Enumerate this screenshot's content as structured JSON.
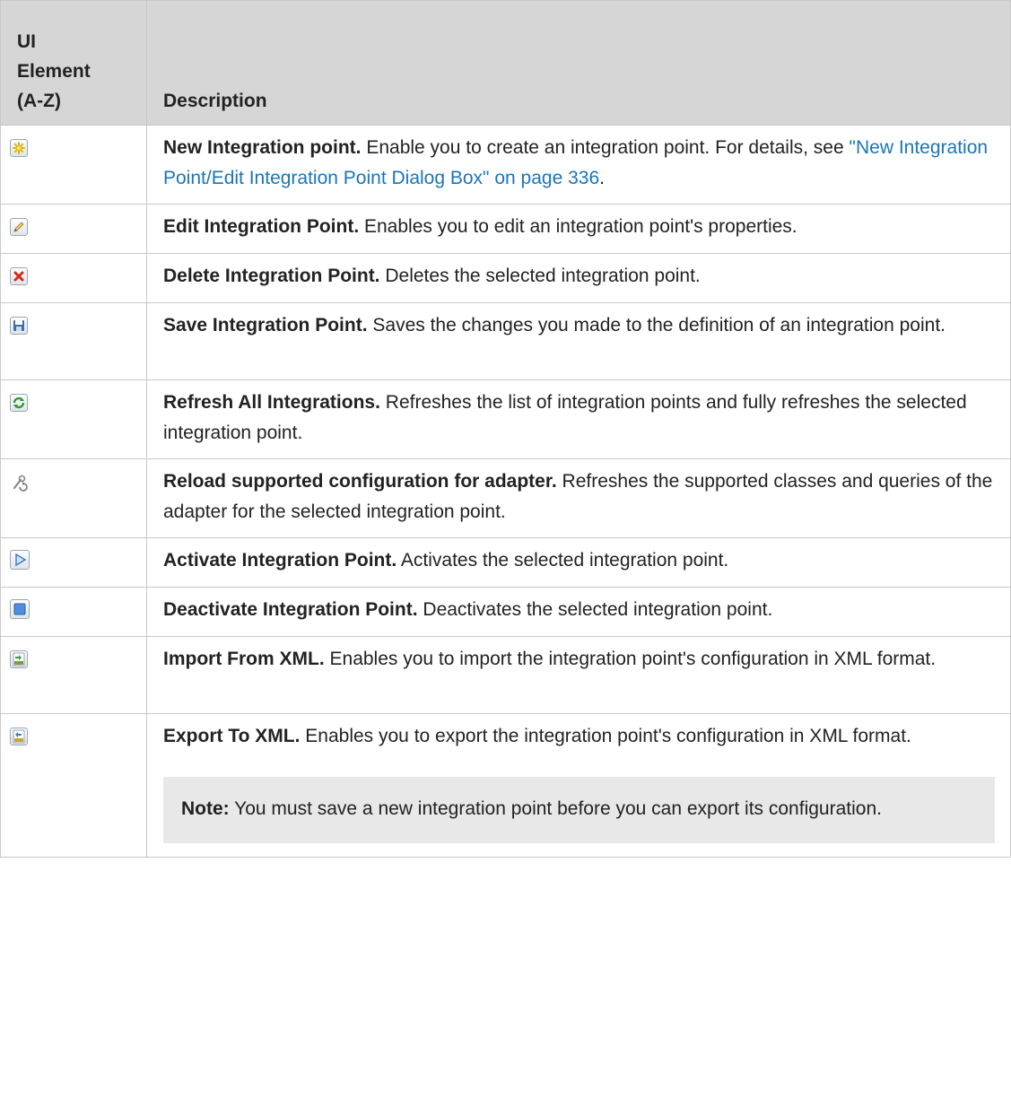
{
  "table": {
    "header": {
      "col1_line1": "UI",
      "col1_line2": "Element",
      "col1_line3": "(A-Z)",
      "col2": "Description"
    },
    "rows": [
      {
        "icon": "new-icon",
        "title": "New Integration point.",
        "text": " Enable you to create an integration point. For details, see ",
        "link": "\"New Integration Point/Edit Integration Point Dialog Box\" on page 336",
        "after_link": "."
      },
      {
        "icon": "edit-pencil-icon",
        "title": "Edit Integration Point.",
        "text": " Enables you to edit an integration point's properties."
      },
      {
        "icon": "delete-x-icon",
        "title": "Delete Integration Point.",
        "text": " Deletes the selected integration point."
      },
      {
        "icon": "save-disk-icon",
        "title": "Save Integration Point.",
        "text": " Saves the changes you made to the definition of an integration point."
      },
      {
        "icon": "refresh-icon",
        "title": "Refresh All Integrations.",
        "text": " Refreshes the list of integration points and fully refreshes the selected integration point."
      },
      {
        "icon": "reload-tools-icon",
        "title": "Reload supported configuration for adapter.",
        "text": " Refreshes the supported classes and queries of the adapter for the selected integration point."
      },
      {
        "icon": "activate-play-icon",
        "title": "Activate Integration Point.",
        "text": " Activates the selected integration point."
      },
      {
        "icon": "deactivate-stop-icon",
        "title": "Deactivate Integration Point.",
        "text": " Deactivates the selected integration point."
      },
      {
        "icon": "import-xml-icon",
        "title": "Import From XML.",
        "text": " Enables you to import the integration point's configuration in XML format."
      },
      {
        "icon": "export-xml-icon",
        "title": "Export To XML.",
        "text": " Enables you to export the integration point's configuration in XML format.",
        "note_label": "Note:",
        "note_text": " You must save a new integration point before you can export its configuration."
      }
    ],
    "colors": {
      "header_bg": "#d6d6d6",
      "link": "#1a75b8",
      "note_bg": "#e8e8e8",
      "border": "#c8c8c8"
    }
  }
}
